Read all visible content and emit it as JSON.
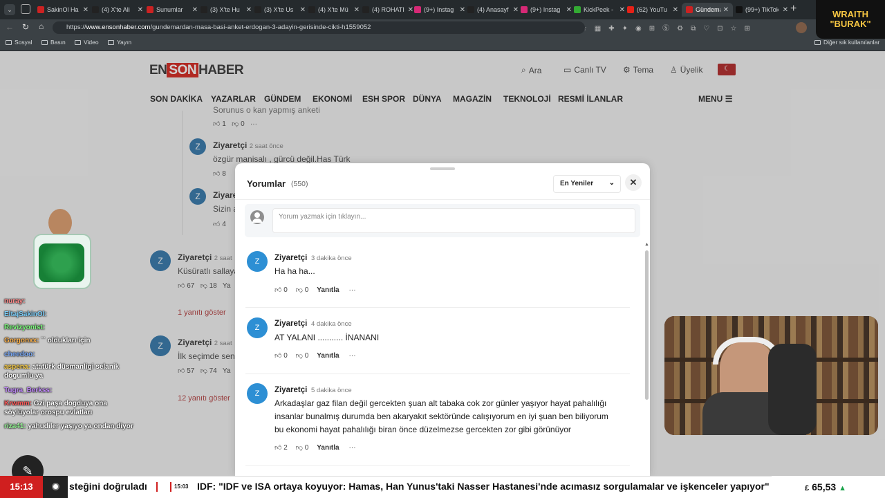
{
  "browser": {
    "tabs": [
      {
        "label": "SakinOl Ha",
        "color": "#cc2222"
      },
      {
        "label": "(4) X'te Ali",
        "color": "#222"
      },
      {
        "label": "Sunumlar",
        "color": "#cc2222"
      },
      {
        "label": "(3) X'te Hu",
        "color": "#222"
      },
      {
        "label": "(3) X'te Us",
        "color": "#222"
      },
      {
        "label": "(4) X'te Mü",
        "color": "#222"
      },
      {
        "label": "(4) ROHATI",
        "color": "#222"
      },
      {
        "label": "(9+) Instag",
        "color": "#d62976"
      },
      {
        "label": "(4) Anasayf",
        "color": "#222"
      },
      {
        "label": "(9+) Instag",
        "color": "#d62976"
      },
      {
        "label": "KickPeek -",
        "color": "#3a3"
      },
      {
        "label": "(62) YouTu",
        "color": "#e62117"
      },
      {
        "label": "Gündemar",
        "color": "#cc2222"
      },
      {
        "label": "(99+) TikTok",
        "color": "#111"
      }
    ],
    "url_prefix": "https://",
    "url_host": "www.ensonhaber.com",
    "url_path": "/gundemardan-masa-basi-anket-erdogan-3-adayin-gerisinde-cikti-h1559052",
    "bookmarks": [
      "Sosyal",
      "Basın",
      "Video",
      "Yayın"
    ],
    "other_bookmarks": "Diğer sık kullanılanlar"
  },
  "site": {
    "logo_en": "EN",
    "logo_son": "SON",
    "logo_haber": "HABER",
    "header_links": [
      "Ara",
      "Canlı TV",
      "Tema",
      "Üyelik"
    ],
    "nav": [
      "SON DAKİKA",
      "YAZARLAR",
      "GÜNDEM",
      "EKONOMİ",
      "ESH SPOR",
      "DÜNYA",
      "MAGAZİN",
      "TEKNOLOJİ",
      "RESMİ İLANLAR"
    ],
    "menu_label": "MENU",
    "bg_comments": {
      "c0_text": "Sorunus o kan yapmış anketi",
      "c0_likes": "1",
      "c0_dislikes": "0",
      "c1_name": "Ziyaretçi",
      "c1_time": "2 saat önce",
      "c1_text": "özgür manisalı , gürcü değil.Has Türk",
      "c1_likes": "8",
      "c2_name": "Ziyaretçi",
      "c2_text": "Sizin a",
      "c2_likes": "4",
      "c3_name": "Ziyaretçi",
      "c3_time": "2 saat",
      "c3_text": "Küsüratlı sallaya",
      "c3_likes": "67",
      "c3_dislikes": "18",
      "c3_reply": "Ya",
      "c3_show": "1 yanıtı göster",
      "c4_name": "Ziyaretçi",
      "c4_time": "2 saat",
      "c4_text": "İlk seçimde sen",
      "c4_likes": "57",
      "c4_dislikes": "74",
      "c4_reply": "Ya",
      "c4_show": "12 yanıtı göster"
    }
  },
  "modal": {
    "title": "Yorumlar",
    "count": "(550)",
    "sort": "En Yeniler",
    "input_placeholder": "Yorum yazmak için tıklayın...",
    "comments": [
      {
        "avatar": "Z",
        "name": "Ziyaretçi",
        "time": "3 dakika önce",
        "lines": [
          "Ha ha ha..."
        ],
        "likes": "0",
        "dislikes": "0",
        "reply": "Yanıtla"
      },
      {
        "avatar": "Z",
        "name": "Ziyaretçi",
        "time": "4 dakika önce",
        "lines": [
          "AT YALANI ........... İNANANI"
        ],
        "likes": "0",
        "dislikes": "0",
        "reply": "Yanıtla"
      },
      {
        "avatar": "Z",
        "name": "Ziyaretçi",
        "time": "5 dakika önce",
        "lines": [
          "Arkadaşlar gaz filan değil gercekten şuan alt tabaka cok zor günler yaşıyor hayat pahalılığı",
          "insanlar bunalmış durumda ben akaryakıt sektöründe calışıyorum en iyi şuan ben biliyorum",
          "bu ekonomi hayat pahalılığı biran önce düzelmezse gercekten zor gibi görünüyor"
        ],
        "likes": "2",
        "dislikes": "0",
        "reply": "Yanıtla"
      }
    ]
  },
  "stream": {
    "brand_line1": "WRAITH",
    "brand_line2": "\"BURAK\"",
    "chat": [
      {
        "user": "nuray:",
        "msg": "",
        "color": "#ff8a8a"
      },
      {
        "user": "EltajSakinOl:",
        "msg": "",
        "color": "#7fd3ff"
      },
      {
        "user": "Revizyonist:",
        "msg": "",
        "color": "#7dff7d"
      },
      {
        "user": "Gorgonxx:",
        "msg": "`` oldukları için",
        "color": "#ffb24a"
      },
      {
        "user": "cheedoo:",
        "msg": "",
        "color": "#7fb0ff"
      },
      {
        "user": "aspena:",
        "msg": "atatürk düsmanligi selanik dogumlu ya",
        "color": "#ffd24a"
      },
      {
        "user": "Tugra_Berkss:",
        "msg": "",
        "color": "#c48bff"
      },
      {
        "user": "Krwmm:",
        "msg": "Gzi paşa dogduya ona söylüyolar orospu evlatları",
        "color": "#ff5a5a"
      },
      {
        "user": "riza41:",
        "msg": "yahudiler yaşıyo ya ondan diyor",
        "color": "#9cff9c"
      }
    ]
  },
  "ticker": {
    "clock": "15:13",
    "item1": "steğini doğruladı",
    "item2_time": "15:03",
    "item2": "IDF: \"IDF ve ISA ortaya koyuyor: Hamas, Han Yunus'taki Nasser Hastanesi'nde acımasız sorgulamalar ve işkenceler yapıyor\" Ha",
    "currency": "£",
    "price": "65,53",
    "trend": "▲"
  }
}
